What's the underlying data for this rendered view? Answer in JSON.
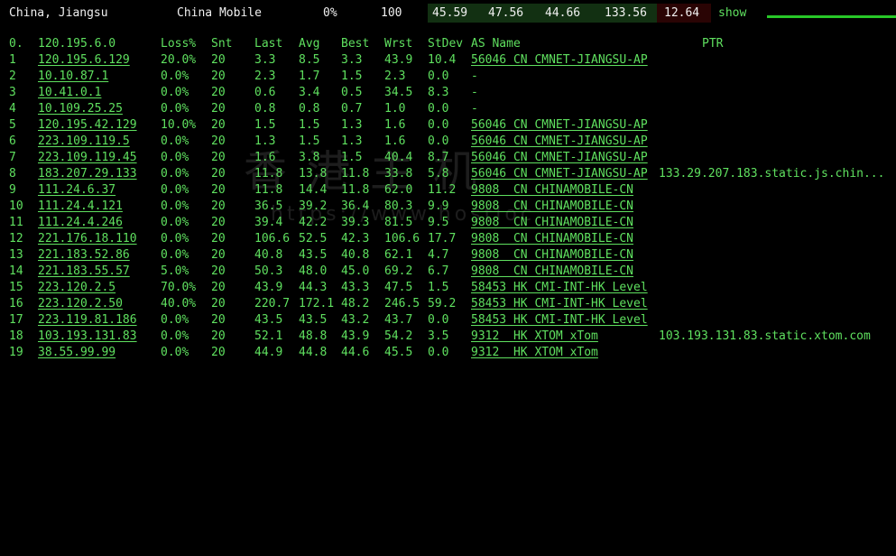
{
  "topbar": {
    "location": "China, Jiangsu",
    "isp": "China Mobile",
    "loss": "0%",
    "count": "100",
    "v1": "45.59",
    "v2": "47.56",
    "v3": "44.66",
    "v4": "133.56",
    "v5": "12.64",
    "show": "show"
  },
  "headers": {
    "hop": "0.",
    "host": "120.195.6.0",
    "loss": "Loss%",
    "snt": "Snt",
    "last": "Last",
    "avg": "Avg",
    "best": "Best",
    "wrst": "Wrst",
    "stdev": "StDev",
    "asname": "AS Name",
    "ptr": "PTR"
  },
  "rows": [
    {
      "hop": "1",
      "host": "120.195.6.129",
      "loss": "20.0%",
      "snt": "20",
      "last": "3.3",
      "avg": "8.5",
      "best": "3.3",
      "wrst": "43.9",
      "stdev": "10.4",
      "asname": "56046 CN CMNET-JIANGSU-AP",
      "ptr": ""
    },
    {
      "hop": "2",
      "host": "10.10.87.1",
      "loss": "0.0%",
      "snt": "20",
      "last": "2.3",
      "avg": "1.7",
      "best": "1.5",
      "wrst": "2.3",
      "stdev": "0.0",
      "asname": "-",
      "ptr": ""
    },
    {
      "hop": "3",
      "host": "10.41.0.1",
      "loss": "0.0%",
      "snt": "20",
      "last": "0.6",
      "avg": "3.4",
      "best": "0.5",
      "wrst": "34.5",
      "stdev": "8.3",
      "asname": "-",
      "ptr": ""
    },
    {
      "hop": "4",
      "host": "10.109.25.25",
      "loss": "0.0%",
      "snt": "20",
      "last": "0.8",
      "avg": "0.8",
      "best": "0.7",
      "wrst": "1.0",
      "stdev": "0.0",
      "asname": "-",
      "ptr": ""
    },
    {
      "hop": "5",
      "host": "120.195.42.129",
      "loss": "10.0%",
      "snt": "20",
      "last": "1.5",
      "avg": "1.5",
      "best": "1.3",
      "wrst": "1.6",
      "stdev": "0.0",
      "asname": "56046 CN CMNET-JIANGSU-AP",
      "ptr": ""
    },
    {
      "hop": "6",
      "host": "223.109.119.5",
      "loss": "0.0%",
      "snt": "20",
      "last": "1.3",
      "avg": "1.5",
      "best": "1.3",
      "wrst": "1.6",
      "stdev": "0.0",
      "asname": "56046 CN CMNET-JIANGSU-AP",
      "ptr": ""
    },
    {
      "hop": "7",
      "host": "223.109.119.45",
      "loss": "0.0%",
      "snt": "20",
      "last": "1.6",
      "avg": "3.8",
      "best": "1.5",
      "wrst": "40.4",
      "stdev": "8.7",
      "asname": "56046 CN CMNET-JIANGSU-AP",
      "ptr": ""
    },
    {
      "hop": "8",
      "host": "183.207.29.133",
      "loss": "0.0%",
      "snt": "20",
      "last": "11.8",
      "avg": "13.8",
      "best": "11.8",
      "wrst": "33.8",
      "stdev": "5.8",
      "asname": "56046 CN CMNET-JIANGSU-AP",
      "ptr": "133.29.207.183.static.js.chin..."
    },
    {
      "hop": "9",
      "host": "111.24.6.37",
      "loss": "0.0%",
      "snt": "20",
      "last": "11.8",
      "avg": "14.4",
      "best": "11.8",
      "wrst": "62.0",
      "stdev": "11.2",
      "asname": "9808  CN CHINAMOBILE-CN",
      "ptr": ""
    },
    {
      "hop": "10",
      "host": "111.24.4.121",
      "loss": "0.0%",
      "snt": "20",
      "last": "36.5",
      "avg": "39.2",
      "best": "36.4",
      "wrst": "80.3",
      "stdev": "9.9",
      "asname": "9808  CN CHINAMOBILE-CN",
      "ptr": ""
    },
    {
      "hop": "11",
      "host": "111.24.4.246",
      "loss": "0.0%",
      "snt": "20",
      "last": "39.4",
      "avg": "42.2",
      "best": "39.3",
      "wrst": "81.5",
      "stdev": "9.5",
      "asname": "9808  CN CHINAMOBILE-CN",
      "ptr": ""
    },
    {
      "hop": "12",
      "host": "221.176.18.110",
      "loss": "0.0%",
      "snt": "20",
      "last": "106.6",
      "avg": "52.5",
      "best": "42.3",
      "wrst": "106.6",
      "stdev": "17.7",
      "asname": "9808  CN CHINAMOBILE-CN",
      "ptr": ""
    },
    {
      "hop": "13",
      "host": "221.183.52.86",
      "loss": "0.0%",
      "snt": "20",
      "last": "40.8",
      "avg": "43.5",
      "best": "40.8",
      "wrst": "62.1",
      "stdev": "4.7",
      "asname": "9808  CN CHINAMOBILE-CN",
      "ptr": ""
    },
    {
      "hop": "14",
      "host": "221.183.55.57",
      "loss": "5.0%",
      "snt": "20",
      "last": "50.3",
      "avg": "48.0",
      "best": "45.0",
      "wrst": "69.2",
      "stdev": "6.7",
      "asname": "9808  CN CHINAMOBILE-CN",
      "ptr": ""
    },
    {
      "hop": "15",
      "host": "223.120.2.5",
      "loss": "70.0%",
      "snt": "20",
      "last": "43.9",
      "avg": "44.3",
      "best": "43.3",
      "wrst": "47.5",
      "stdev": "1.5",
      "asname": "58453 HK CMI-INT-HK Level",
      "ptr": ""
    },
    {
      "hop": "16",
      "host": "223.120.2.50",
      "loss": "40.0%",
      "snt": "20",
      "last": "220.7",
      "avg": "172.1",
      "best": "48.2",
      "wrst": "246.5",
      "stdev": "59.2",
      "asname": "58453 HK CMI-INT-HK Level",
      "ptr": ""
    },
    {
      "hop": "17",
      "host": "223.119.81.186",
      "loss": "0.0%",
      "snt": "20",
      "last": "43.5",
      "avg": "43.5",
      "best": "43.2",
      "wrst": "43.7",
      "stdev": "0.0",
      "asname": "58453 HK CMI-INT-HK Level",
      "ptr": ""
    },
    {
      "hop": "18",
      "host": "103.193.131.83",
      "loss": "0.0%",
      "snt": "20",
      "last": "52.1",
      "avg": "48.8",
      "best": "43.9",
      "wrst": "54.2",
      "stdev": "3.5",
      "asname": "9312  HK XTOM xTom",
      "ptr": "103.193.131.83.static.xtom.com"
    },
    {
      "hop": "19",
      "host": "38.55.99.99",
      "loss": "0.0%",
      "snt": "20",
      "last": "44.9",
      "avg": "44.8",
      "best": "44.6",
      "wrst": "45.5",
      "stdev": "0.0",
      "asname": "9312  HK XTOM xTom",
      "ptr": ""
    }
  ],
  "watermark": {
    "text": "香港主机",
    "url": "https://www.hostloc"
  },
  "colors": {
    "background": "#000000",
    "text_green": "#5fe05f",
    "text_white": "#f0f0f0",
    "accent_line": "#28c828"
  }
}
